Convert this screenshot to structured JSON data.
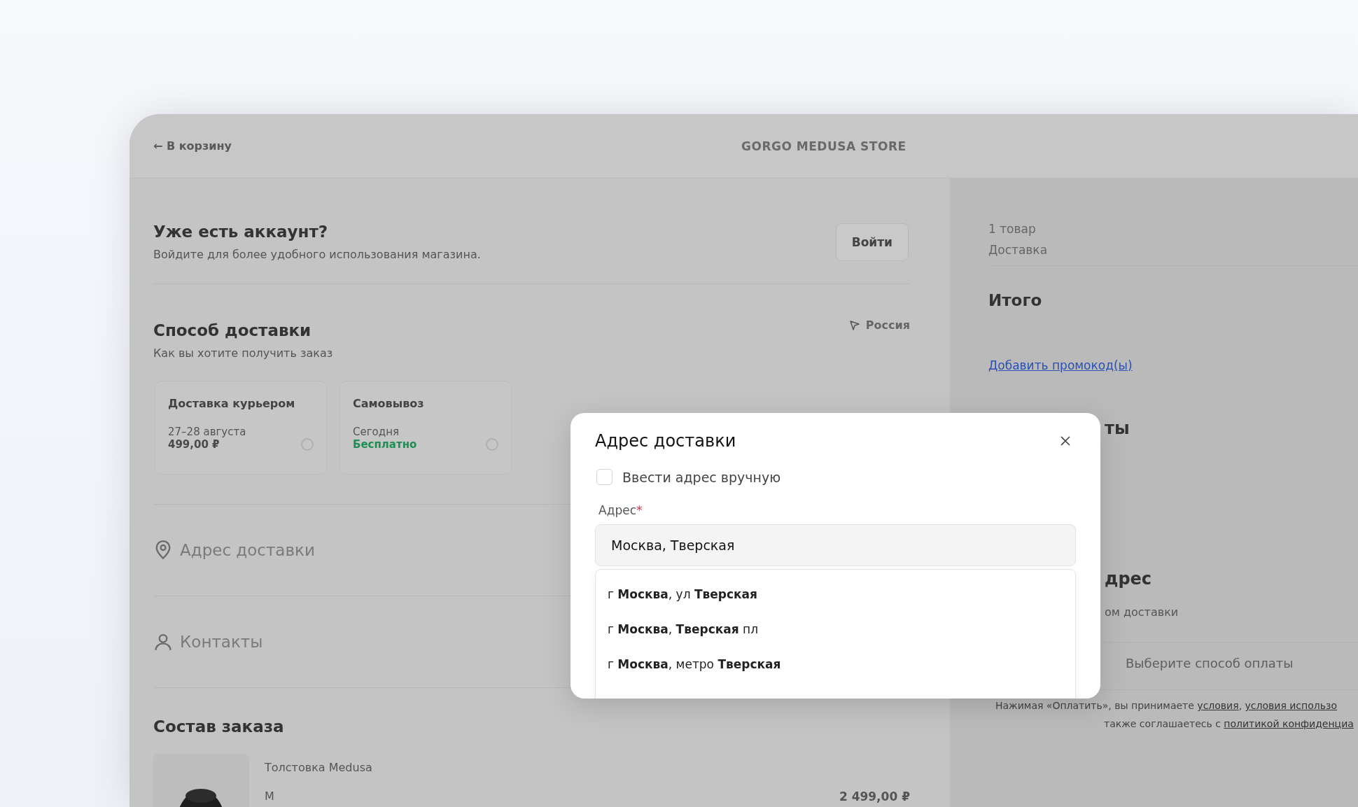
{
  "header": {
    "back_link": "← В корзину",
    "store_name": "GORGO MEDUSA STORE"
  },
  "account": {
    "title": "Уже есть аккаунт?",
    "subtitle": "Войдите для более удобного использования магазина.",
    "login_button": "Войти"
  },
  "delivery": {
    "title": "Способ доставки",
    "subtitle": "Как вы хотите получить заказ",
    "country": "Россия",
    "options": [
      {
        "name": "Доставка курьером",
        "date": "27–28 августа",
        "price": "499,00 ₽",
        "color": "#4a4a4a",
        "selected": false
      },
      {
        "name": "Самовывоз",
        "date": "Сегодня",
        "price": "Бесплатно",
        "color": "#1f8f55",
        "selected": false
      }
    ]
  },
  "sections": [
    {
      "kind": "pin",
      "label": "Адрес доставки"
    },
    {
      "kind": "person",
      "label": "Контакты"
    }
  ],
  "order": {
    "title": "Состав заказа",
    "items": [
      {
        "kind": "picture",
        "name": "Толстовка Medusa",
        "size": "M",
        "price": "2 499,00 ₽"
      }
    ]
  },
  "summary": {
    "rows": [
      "1 товар",
      "Доставка"
    ],
    "total_label": "Итого",
    "promo_link": "Добавить промокод(ы)",
    "heading_fragment": "ты",
    "address_fragment": "дрес",
    "address_sub_fragment": "ом доставки",
    "pay_button": "Выберите способ оплаты",
    "terms_lines": [
      "Нажимая «Оплатить», вы принимаете **условия**, **условия использо**",
      "также соглашаетесь с **политикой конфиденциа**"
    ]
  },
  "modal": {
    "title": "Адрес доставки",
    "manual_entry": {
      "label": "Ввести адрес вручную",
      "checked": false
    },
    "address": {
      "label": "Адрес",
      "required_mark": "*",
      "value": "Москва, Тверская"
    },
    "suggestions": [
      {
        "text": "г **Москва**, ул **Тверская**"
      },
      {
        "text": "г **Москва**, **Тверская** пл"
      },
      {
        "text": "г **Москва**, метро **Тверская**"
      }
    ]
  }
}
